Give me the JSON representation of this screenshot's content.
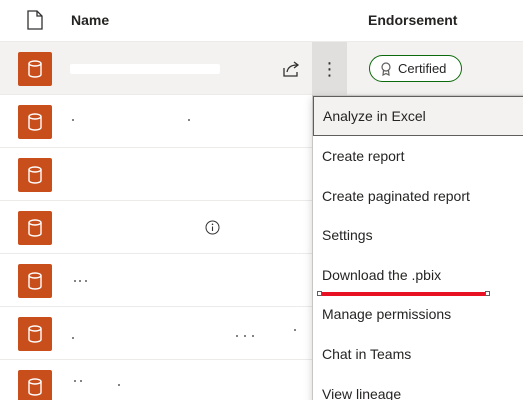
{
  "header": {
    "name_label": "Name",
    "endorsement_label": "Endorsement"
  },
  "row_selected": {
    "badge_label": "Certified"
  },
  "menu": {
    "items": [
      {
        "label": "Analyze in Excel"
      },
      {
        "label": "Create report"
      },
      {
        "label": "Create paginated report"
      },
      {
        "label": "Settings"
      },
      {
        "label": "Download the .pbix"
      },
      {
        "label": "Manage permissions"
      },
      {
        "label": "Chat in Teams"
      },
      {
        "label": "View lineage"
      }
    ]
  },
  "colors": {
    "dataset_icon": "#c84e1c",
    "certified_border": "#0b6a0b",
    "annotation_red": "#e81123"
  },
  "icons": {
    "header": "file-icon",
    "dataset": "database-icon",
    "share": "share-icon",
    "more": "more-options-icon",
    "certified": "ribbon-icon",
    "info": "info-icon"
  }
}
